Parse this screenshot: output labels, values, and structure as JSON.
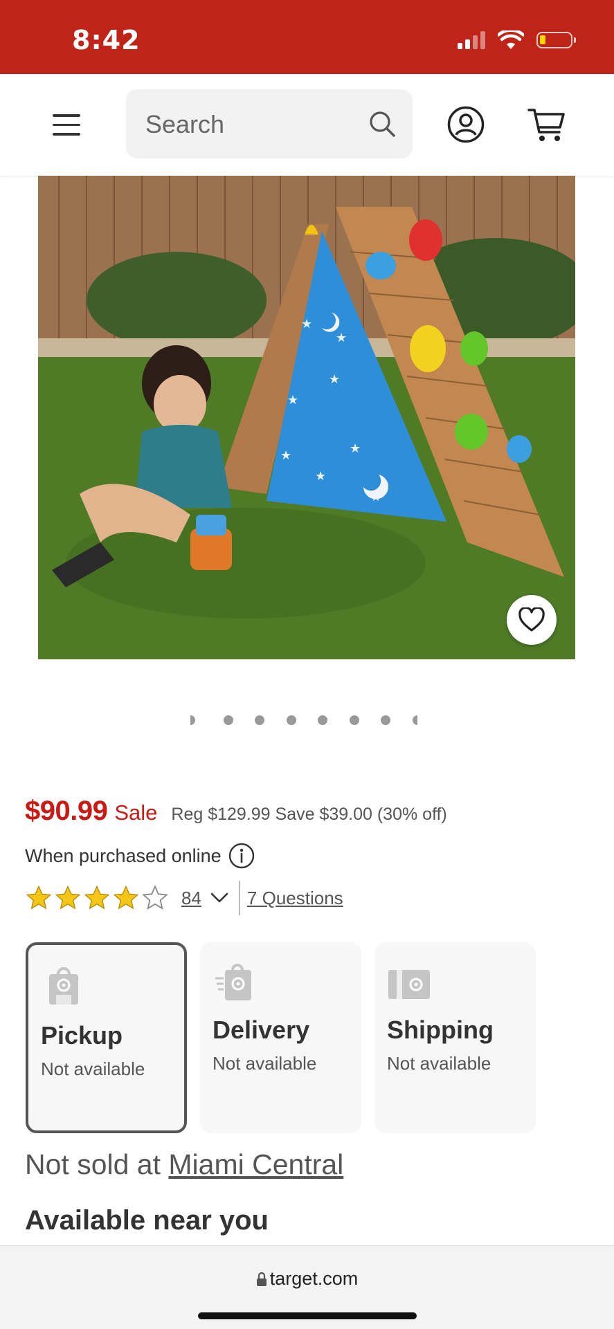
{
  "status_bar": {
    "time": "8:42"
  },
  "header": {
    "search": {
      "placeholder": "Search"
    }
  },
  "product": {
    "image_alt": "KidKraft A-frame hideaway with climbing wall",
    "price": "$90.99",
    "sale_label": "Sale",
    "reg_text": "Reg $129.99 Save $39.00 (30% off)",
    "online_note": "When purchased online",
    "rating": {
      "stars": 4,
      "max": 5,
      "count": "84"
    },
    "questions_link": "7 Questions",
    "carousel": {
      "dots": 8
    }
  },
  "fulfillment": [
    {
      "title": "Pickup",
      "status": "Not available",
      "selected": true
    },
    {
      "title": "Delivery",
      "status": "Not available",
      "selected": false
    },
    {
      "title": "Shipping",
      "status": "Not available",
      "selected": false
    }
  ],
  "store": {
    "prefix": "Not sold at",
    "name": "Miami Central"
  },
  "available_heading": "Available near you",
  "browser": {
    "url": "target.com"
  },
  "colors": {
    "brand_red": "#bf2419",
    "sale_red": "#c81b14",
    "star_gold": "#f5c518"
  }
}
